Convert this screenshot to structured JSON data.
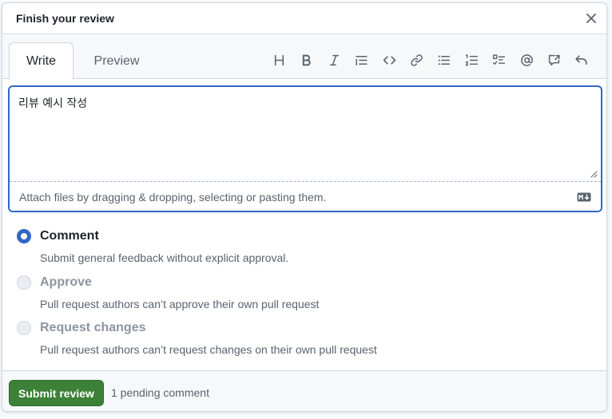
{
  "dialog": {
    "title": "Finish your review",
    "close_icon": "x-icon"
  },
  "tabs": [
    {
      "label": "Write",
      "active": true
    },
    {
      "label": "Preview",
      "active": false
    }
  ],
  "toolbar": {
    "icons": [
      "heading-icon",
      "bold-icon",
      "italic-icon",
      "quote-icon",
      "code-icon",
      "link-icon",
      "unordered-list-icon",
      "ordered-list-icon",
      "task-list-icon",
      "mention-icon",
      "cross-reference-icon",
      "undo-icon"
    ]
  },
  "editor": {
    "value": "리뷰 예시 작성",
    "attach_hint": "Attach files by dragging & dropping, selecting or pasting them.",
    "markdown_icon": "markdown-icon"
  },
  "options": [
    {
      "label": "Comment",
      "description": "Submit general feedback without explicit approval.",
      "checked": true,
      "disabled": false
    },
    {
      "label": "Approve",
      "description": "Pull request authors can’t approve their own pull request",
      "checked": false,
      "disabled": true
    },
    {
      "label": "Request changes",
      "description": "Pull request authors can’t request changes on their own pull request",
      "checked": false,
      "disabled": true
    }
  ],
  "footer": {
    "submit_label": "Submit review",
    "pending_text": "1 pending comment"
  },
  "colors": {
    "accent": "#2f67c7",
    "submit": "#3c8137",
    "muted_text": "#59636e",
    "disabled_text": "#8c959f"
  }
}
